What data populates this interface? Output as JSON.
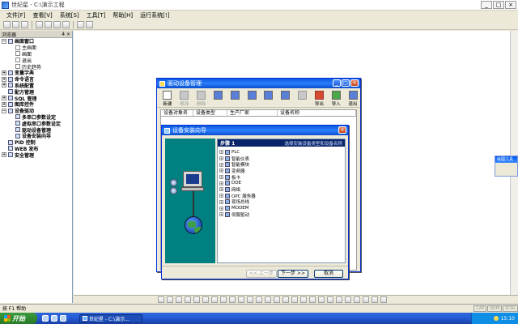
{
  "window": {
    "title": "世纪星 - C:\\演示工程",
    "buttons": [
      "_",
      "□",
      "×"
    ]
  },
  "menu": [
    "文件[F]",
    "查看[V]",
    "系统[S]",
    "工具[T]",
    "帮助[H]",
    "运行系统[!]"
  ],
  "tree": {
    "header": "浏览器",
    "header_buttons": "4 ×",
    "nodes": [
      {
        "pm": "−",
        "label": "画面窗口",
        "level": 0,
        "bold": true,
        "icon": "folder-icon"
      },
      {
        "pm": "",
        "label": "主画面",
        "level": 1,
        "bold": false,
        "icon": "page-icon"
      },
      {
        "pm": "",
        "label": "画面",
        "level": 1,
        "bold": false,
        "icon": "page-icon"
      },
      {
        "pm": "",
        "label": "退出",
        "level": 1,
        "bold": false,
        "icon": "page-icon"
      },
      {
        "pm": "",
        "label": "历史趋势",
        "level": 1,
        "bold": false,
        "icon": "page-icon"
      },
      {
        "pm": "+",
        "label": "变量字典",
        "level": 0,
        "bold": true,
        "icon": "dictionary-icon"
      },
      {
        "pm": "+",
        "label": "命令语言",
        "level": 0,
        "bold": true,
        "icon": "script-icon"
      },
      {
        "pm": "+",
        "label": "系统配置",
        "level": 0,
        "bold": true,
        "icon": "config-icon"
      },
      {
        "pm": "",
        "label": "配方管理",
        "level": 0,
        "bold": true,
        "icon": "recipe-icon"
      },
      {
        "pm": "+",
        "label": "SQL 管理",
        "level": 0,
        "bold": true,
        "icon": "database-icon"
      },
      {
        "pm": "+",
        "label": "图库控件",
        "level": 0,
        "bold": true,
        "icon": "gallery-icon"
      },
      {
        "pm": "−",
        "label": "设备驱动",
        "level": 0,
        "bold": true,
        "icon": "driver-icon"
      },
      {
        "pm": "",
        "label": "多串口参数设定",
        "level": 1,
        "bold": true,
        "icon": "serial-icon"
      },
      {
        "pm": "",
        "label": "虚拟串口参数设定",
        "level": 1,
        "bold": true,
        "icon": "serial-icon"
      },
      {
        "pm": "",
        "label": "驱动设备管理",
        "level": 1,
        "bold": true,
        "icon": "device-icon"
      },
      {
        "pm": "",
        "label": "设备安装向导",
        "level": 1,
        "bold": true,
        "icon": "wizard-icon"
      },
      {
        "pm": "",
        "label": "PID 控制",
        "level": 0,
        "bold": true,
        "icon": "pid-icon"
      },
      {
        "pm": "",
        "label": "WEB 发布",
        "level": 0,
        "bold": true,
        "icon": "web-icon"
      },
      {
        "pm": "+",
        "label": "安全管理",
        "level": 0,
        "bold": true,
        "icon": "security-icon"
      }
    ]
  },
  "device_manager": {
    "title": "驱动设备管理",
    "tools": [
      {
        "label": "新建",
        "glyph": "new-icon",
        "enabled": true,
        "color": "white"
      },
      {
        "label": "修改",
        "glyph": "edit-icon",
        "enabled": false,
        "color": "grey"
      },
      {
        "label": "删除",
        "glyph": "delete-icon",
        "enabled": false,
        "color": "grey"
      },
      {
        "label": "",
        "glyph": "view-large-icon",
        "enabled": true,
        "color": "blue"
      },
      {
        "label": "",
        "glyph": "view-small-icon",
        "enabled": true,
        "color": "blue"
      },
      {
        "label": "",
        "glyph": "view-list-icon",
        "enabled": true,
        "color": "blue"
      },
      {
        "label": "",
        "glyph": "view-detail-icon",
        "enabled": true,
        "color": "blue"
      },
      {
        "label": "",
        "glyph": "grid-icon",
        "enabled": true,
        "color": "blue"
      },
      {
        "label": "",
        "glyph": "folder-icon",
        "enabled": false,
        "color": "grey"
      },
      {
        "label": "导出",
        "glyph": "export-icon",
        "enabled": true,
        "color": "red"
      },
      {
        "label": "导入",
        "glyph": "import-icon",
        "enabled": true,
        "color": "green"
      },
      {
        "label": "退出",
        "glyph": "exit-icon",
        "enabled": true,
        "color": "blue"
      }
    ],
    "columns": [
      "设备对象名",
      "设备类型",
      "生产厂家",
      "设备名称"
    ]
  },
  "wizard": {
    "title": "设备安装向导",
    "step_label": "步骤 1",
    "step_hint": "选择安装设备类型和设备名称",
    "items": [
      {
        "label": "PLC",
        "icon": "plc-icon"
      },
      {
        "label": "智能仪表",
        "icon": "meter-icon"
      },
      {
        "label": "智能模块",
        "icon": "module-icon"
      },
      {
        "label": "变频器",
        "icon": "inverter-icon"
      },
      {
        "label": "板卡",
        "icon": "board-icon"
      },
      {
        "label": "DDE",
        "icon": "dde-icon"
      },
      {
        "label": "网络",
        "icon": "network-icon"
      },
      {
        "label": "OPC 服务器",
        "icon": "opc-icon"
      },
      {
        "label": "现场总线",
        "icon": "fieldbus-icon"
      },
      {
        "label": "MODEM",
        "icon": "modem-icon"
      },
      {
        "label": "伺服驱动",
        "icon": "servo-icon"
      }
    ],
    "buttons": {
      "back": "<< 上一步",
      "next": "下一步 >>",
      "cancel": "取消"
    }
  },
  "floating_toolbar": {
    "title": "绘图工具"
  },
  "statusbar": {
    "help": "按 F1 帮助",
    "indicators": [
      "CAP",
      "NUM",
      "SCRL"
    ]
  },
  "taskbar": {
    "start": "开始",
    "task": "世纪星 - C:\\演示...",
    "clock": "15:10"
  }
}
